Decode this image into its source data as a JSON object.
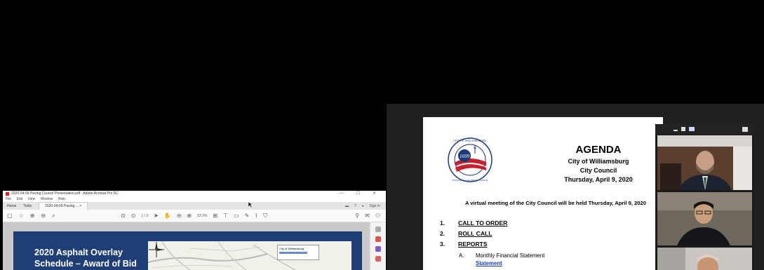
{
  "acrobat": {
    "title": "2020-04-09 Paving Council Presentation.pdf - Adobe Acrobat Pro DC",
    "window_controls": "— ☐ ✕",
    "menu": [
      "File",
      "Edit",
      "View",
      "Window",
      "Help"
    ],
    "tabs": {
      "home": "Home",
      "tools": "Tools",
      "document": "2020-04-09 Paving ... ×"
    },
    "sign_in": "Sign In",
    "page_indicator": "1 / 3",
    "zoom_level": "53.3%",
    "slide": {
      "title": "2020 Asphalt Overlay Schedule – Award of Bid",
      "map_legend": "City of Williamsburg"
    },
    "colors": {
      "slide_bg": "#1f3e75",
      "toolbar_accent": "#2a6ebb"
    }
  },
  "agenda": {
    "title": "AGENDA",
    "org": "City of Williamsburg",
    "body": "City Council",
    "date": "Thursday, April 9, 2020",
    "notice": "A virtual meeting of the City Council will be held Thursday, April 9, 2020",
    "items": [
      {
        "num": "1.",
        "label": "CALL TO ORDER"
      },
      {
        "num": "2.",
        "label": "ROLL CALL"
      },
      {
        "num": "3.",
        "label": "REPORTS"
      }
    ],
    "subitem": {
      "letter": "A.",
      "label": "Monthly Financial Statement",
      "link": "Statement"
    },
    "seal": {
      "year": "1699",
      "top_text": "CITY OF WILLIAMSBURG",
      "bottom_text": "VIRGINIA'S COLONIAL CAPITAL"
    }
  },
  "zoom": {
    "controls": [
      "minimize-icon",
      "restore-icon",
      "grid-view-icon",
      "speaker-view-icon"
    ],
    "participants": 3
  }
}
